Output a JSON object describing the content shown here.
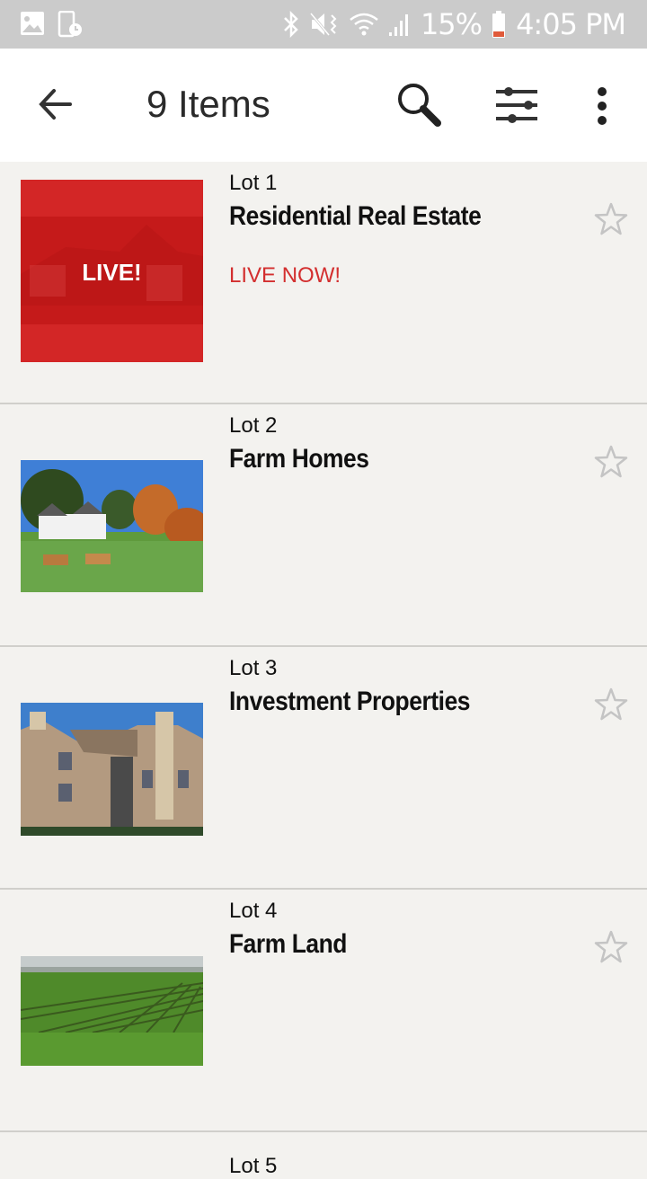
{
  "status_bar": {
    "battery": "15%",
    "time": "4:05 PM",
    "icons": [
      "image-icon",
      "screen-timer-icon",
      "bluetooth-icon",
      "vibrate-mute-icon",
      "wifi-icon",
      "signal-icon",
      "battery-low-icon"
    ],
    "battery_color": "#e05a3a"
  },
  "app_bar": {
    "title": "9 Items",
    "icons": [
      "back-arrow-icon",
      "search-icon",
      "filter-sliders-icon",
      "more-vert-icon"
    ]
  },
  "lots": [
    {
      "number": "Lot 1",
      "title": "Residential Real Estate",
      "status": "LIVE NOW!",
      "thumb_label": "LIVE!",
      "thumb": "live-overlay-house",
      "favorited": false
    },
    {
      "number": "Lot 2",
      "title": "Farm Homes",
      "status": "",
      "thumb": "farmhouse-cows",
      "favorited": false
    },
    {
      "number": "Lot 3",
      "title": "Investment Properties",
      "status": "",
      "thumb": "apartment-building",
      "favorited": false
    },
    {
      "number": "Lot 4",
      "title": "Farm Land",
      "status": "",
      "thumb": "crop-field",
      "favorited": false
    },
    {
      "number": "Lot 5"
    }
  ],
  "colors": {
    "live_red": "#d32f2f",
    "background": "#f3f2ef",
    "app_bar_bg": "#ffffff",
    "status_bar_bg": "#cbcbcb"
  }
}
